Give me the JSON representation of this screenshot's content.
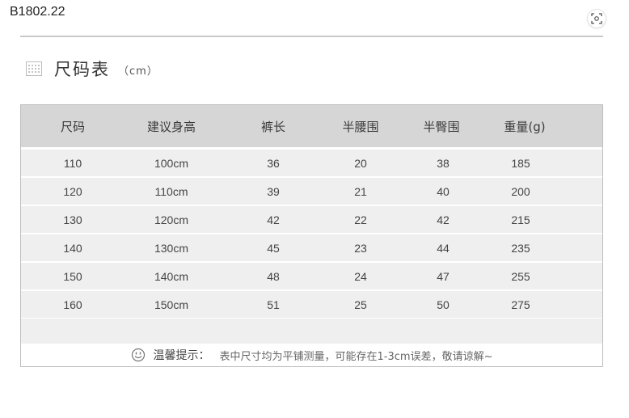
{
  "header": {
    "product_code": "B1802.22"
  },
  "icons": {
    "scan": "scan-icon",
    "title": "grid-icon",
    "tip": "smile-icon"
  },
  "title": {
    "text": "尺码表",
    "unit": "（cm）"
  },
  "table": {
    "columns": [
      "尺码",
      "建议身高",
      "裤长",
      "半腰围",
      "半臀围",
      "重量(g)"
    ],
    "rows": [
      [
        "110",
        "100cm",
        "36",
        "20",
        "38",
        "185"
      ],
      [
        "120",
        "110cm",
        "39",
        "21",
        "40",
        "200"
      ],
      [
        "130",
        "120cm",
        "42",
        "22",
        "42",
        "215"
      ],
      [
        "140",
        "130cm",
        "45",
        "23",
        "44",
        "235"
      ],
      [
        "150",
        "140cm",
        "48",
        "24",
        "47",
        "255"
      ],
      [
        "160",
        "150cm",
        "51",
        "25",
        "50",
        "275"
      ]
    ]
  },
  "tip": {
    "label": "温馨提示：",
    "text": "表中尺寸均为平铺测量，可能存在1-3cm误差，敬请谅解~"
  },
  "colors": {
    "header_bg": "#d6d6d6",
    "row_bg": "#efefef",
    "border": "#bdbdbd"
  }
}
